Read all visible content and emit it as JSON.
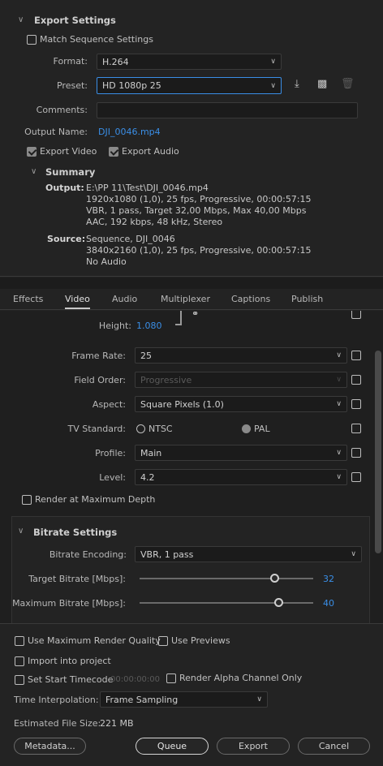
{
  "export_settings": {
    "header": "Export Settings",
    "match_sequence": {
      "label": "Match Sequence Settings",
      "checked": false
    },
    "format": {
      "label": "Format:",
      "value": "H.264"
    },
    "preset": {
      "label": "Preset:",
      "value": "HD 1080p 25"
    },
    "comments": {
      "label": "Comments:",
      "value": ""
    },
    "output_name": {
      "label": "Output Name:",
      "value": "DJI_0046.mp4"
    },
    "export_video": {
      "label": "Export Video",
      "checked": true
    },
    "export_audio": {
      "label": "Export Audio",
      "checked": true
    }
  },
  "summary": {
    "header": "Summary",
    "output_label": "Output:",
    "output_lines": [
      "E:\\PP 11\\Test\\DJI_0046.mp4",
      "1920x1080 (1,0), 25 fps, Progressive, 00:00:57:15",
      "VBR, 1 pass, Target 32,00 Mbps, Max 40,00 Mbps",
      "AAC, 192 kbps, 48 kHz, Stereo"
    ],
    "source_label": "Source:",
    "source_lines": [
      "Sequence, DJI_0046",
      "3840x2160 (1,0), 25 fps, Progressive, 00:00:57:15",
      "No Audio"
    ]
  },
  "tabs": [
    "Effects",
    "Video",
    "Audio",
    "Multiplexer",
    "Captions",
    "Publish"
  ],
  "active_tab": "Video",
  "video": {
    "height": {
      "label": "Height:",
      "value": "1.080"
    },
    "frame_rate": {
      "label": "Frame Rate:",
      "value": "25"
    },
    "field_order": {
      "label": "Field Order:",
      "value": "Progressive"
    },
    "aspect": {
      "label": "Aspect:",
      "value": "Square Pixels (1.0)"
    },
    "tv_standard": {
      "label": "TV Standard:",
      "ntsc": "NTSC",
      "pal": "PAL",
      "selected": "PAL"
    },
    "profile": {
      "label": "Profile:",
      "value": "Main"
    },
    "level": {
      "label": "Level:",
      "value": "4.2"
    },
    "render_max_depth": {
      "label": "Render at Maximum Depth",
      "checked": false
    }
  },
  "bitrate": {
    "header": "Bitrate Settings",
    "encoding": {
      "label": "Bitrate Encoding:",
      "value": "VBR, 1 pass"
    },
    "target": {
      "label": "Target Bitrate [Mbps]:",
      "value": "32",
      "level": 0.78
    },
    "maximum": {
      "label": "Maximum Bitrate [Mbps]:",
      "value": "40",
      "level": 0.8
    }
  },
  "bottom": {
    "use_max_render": {
      "label": "Use Maximum Render Quality",
      "checked": false
    },
    "use_previews": {
      "label": "Use Previews",
      "checked": false
    },
    "import_project": {
      "label": "Import into project",
      "checked": false
    },
    "set_start_tc": {
      "label": "Set Start Timecode",
      "checked": false,
      "value": "00:00:00:00"
    },
    "render_alpha": {
      "label": "Render Alpha Channel Only",
      "checked": false
    },
    "time_interp": {
      "label": "Time Interpolation:",
      "value": "Frame Sampling"
    },
    "file_size": {
      "label": "Estimated File Size:",
      "value": "221 MB"
    },
    "buttons": {
      "metadata": "Metadata...",
      "queue": "Queue",
      "export": "Export",
      "cancel": "Cancel"
    }
  },
  "colors": {
    "accent": "#3a8ee6",
    "bg": "#232323",
    "field": "#1b1b1b"
  }
}
